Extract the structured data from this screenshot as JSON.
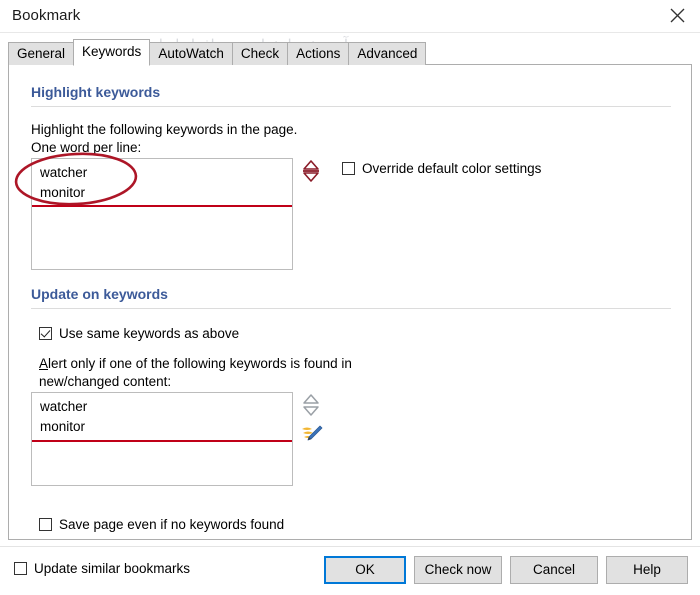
{
  "window": {
    "title": "Bookmark",
    "close_label": "Close",
    "watermark_top": "آموزش دانشنامه نرم افزار ایران",
    "watermark_sub": "آموزش دانشنامه نرم افزار ایران"
  },
  "tabs": [
    {
      "label": "General",
      "active": false
    },
    {
      "label": "Keywords",
      "active": true
    },
    {
      "label": "AutoWatch",
      "active": false
    },
    {
      "label": "Check",
      "active": false
    },
    {
      "label": "Actions",
      "active": false
    },
    {
      "label": "Advanced",
      "active": false
    }
  ],
  "highlight_section": {
    "header": "Highlight keywords",
    "description_line1": "Highlight the following keywords in the page.",
    "description_line2": "One word per line:",
    "keywords_textarea": {
      "value_lines": [
        "watcher",
        "monitor"
      ]
    },
    "spinner_icon": "up-down-spinner-icon",
    "override_checkbox": {
      "label": "Override default color settings",
      "checked": false
    }
  },
  "update_section": {
    "header": "Update on keywords",
    "use_same_checkbox": {
      "label": "Use same keywords as above",
      "checked": true
    },
    "alert_line1_accel": "A",
    "alert_line1_rest": "lert only if one of the following keywords is found in",
    "alert_line2": "new/changed content:",
    "alert_textarea": {
      "value_lines": [
        "watcher",
        "monitor"
      ]
    },
    "spinner_icon": "up-down-spinner-icon",
    "edit_icon": "pencil-edit-icon",
    "save_checkbox": {
      "label": "Save page even if no keywords found",
      "checked": false
    }
  },
  "footer": {
    "update_similar_checkbox": {
      "label": "Update similar bookmarks",
      "checked": false
    },
    "buttons": [
      {
        "label": "OK",
        "default": true
      },
      {
        "label": "Check now",
        "default": false
      },
      {
        "label": "Cancel",
        "default": false
      },
      {
        "label": "Help",
        "default": false
      }
    ]
  },
  "colors": {
    "group_header": "#3c5a99",
    "annotation_red": "#c00018",
    "focus_blue": "#0078d7",
    "tab_inactive": "#e1e1e1"
  }
}
